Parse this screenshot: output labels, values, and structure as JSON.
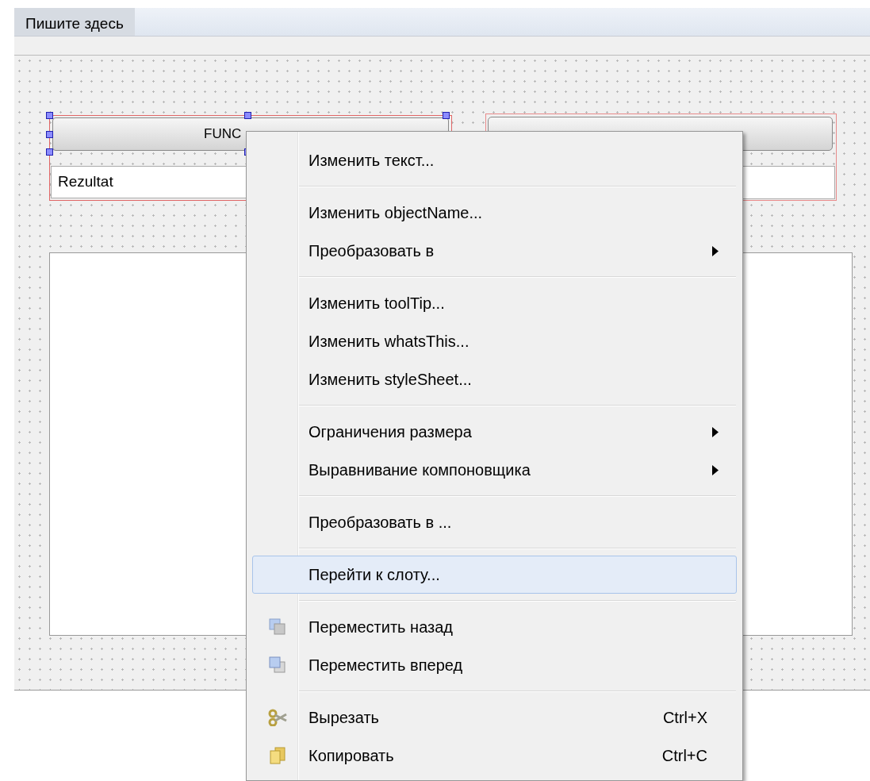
{
  "menu_bar": {
    "placeholder_item": "Пишите здесь"
  },
  "form": {
    "left_group": {
      "button": "FUNC",
      "line_edit": "Rezultat",
      "selected": true
    },
    "right_group": {
      "selected": false
    }
  },
  "context_menu": {
    "groups": [
      [
        {
          "label": "Изменить текст...",
          "submenu": false,
          "selected": false
        }
      ],
      [
        {
          "label": "Изменить objectName...",
          "submenu": false,
          "selected": false
        },
        {
          "label": "Преобразовать в",
          "submenu": true,
          "selected": false
        }
      ],
      [
        {
          "label": "Изменить toolTip...",
          "submenu": false,
          "selected": false
        },
        {
          "label": "Изменить whatsThis...",
          "submenu": false,
          "selected": false
        },
        {
          "label": "Изменить styleSheet...",
          "submenu": false,
          "selected": false
        }
      ],
      [
        {
          "label": "Ограничения размера",
          "submenu": true,
          "selected": false
        },
        {
          "label": "Выравнивание компоновщика",
          "submenu": true,
          "selected": false
        }
      ],
      [
        {
          "label": "Преобразовать в ...",
          "submenu": false,
          "selected": false
        }
      ],
      [
        {
          "label": "Перейти к слоту...",
          "submenu": false,
          "selected": true
        }
      ],
      [
        {
          "label": "Переместить назад",
          "submenu": false,
          "selected": false
        },
        {
          "label": "Переместить вперед",
          "submenu": false,
          "selected": false
        }
      ],
      [
        {
          "label": "Вырезать",
          "shortcut": "Ctrl+X",
          "submenu": false,
          "selected": false
        },
        {
          "label": "Копировать",
          "shortcut": "Ctrl+C",
          "submenu": false,
          "selected": false
        }
      ]
    ]
  }
}
